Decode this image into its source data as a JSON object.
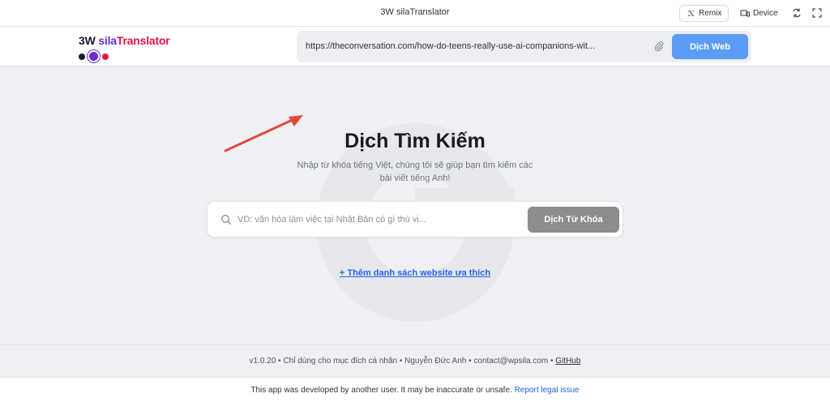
{
  "window": {
    "title": "3W silaTranslator",
    "remix_label": "Remix",
    "device_label": "Device"
  },
  "header": {
    "logo": {
      "part1": "3W ",
      "part2": "sila",
      "part3": "Translator"
    },
    "url_value": "https://theconversation.com/how-do-teens-really-use-ai-companions-wit...",
    "translate_web_label": "Dịch Web"
  },
  "main": {
    "heading": "Dịch Tìm Kiếm",
    "subtitle": "Nhập từ khóa tiếng Việt, chúng tôi sẽ giúp bạn tìm kiếm các bài viết tiếng Anh!",
    "search_placeholder": "VD: văn hóa làm việc tại Nhật Bản có gì thú vị...",
    "translate_keyword_label": "Dịch Từ Khóa",
    "add_favorites_link": "+ Thêm danh sách website ưa thích"
  },
  "footer": {
    "info": "v1.0.20 • Chỉ dùng cho mục đích cá nhân • Nguyễn Đức Anh • contact@wpsila.com • ",
    "github": "GitHub",
    "notice": "This app was developed by another user. It may be inaccurate or unsafe. ",
    "report": "Report legal issue"
  },
  "colors": {
    "accent_blue": "#5b9cf6",
    "logo_purple": "#6a2cd8",
    "logo_red": "#e0134a",
    "arrow_red": "#e24a3b"
  },
  "icons": [
    "remix-icon",
    "device-icon",
    "refresh-icon",
    "fullscreen-icon",
    "paperclip-icon",
    "search-icon",
    "arrow-annotation"
  ]
}
